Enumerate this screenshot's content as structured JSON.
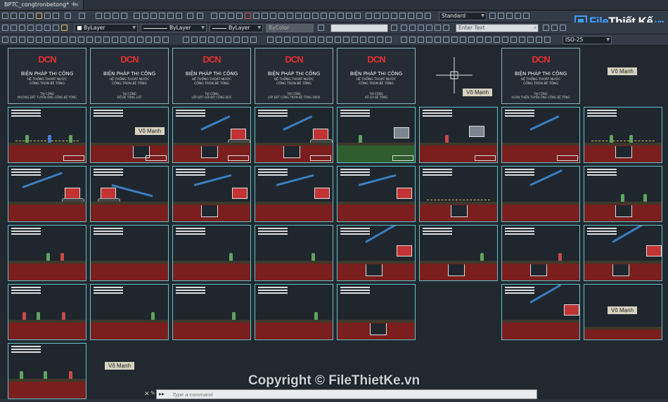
{
  "tabs": [
    {
      "label": "BPTC_congtronbetong*"
    }
  ],
  "tab_add": "+",
  "toolbar": {
    "text_style": "Standard",
    "layer_color": "ByLayer",
    "linetype": "ByLayer",
    "lineweight": "ByLayer",
    "plot_style": "ByColor",
    "enter_text_placeholder": "Enter Text",
    "dim_style": "ISO-25"
  },
  "brand": {
    "part1": "File",
    "part2": "Thiết Kế",
    "suffix": ".vn"
  },
  "covers": [
    {
      "logo": "DCN",
      "title": "BIỆN PHÁP THI CÔNG",
      "sub1": "HỆ THỐNG THOÁT NƯỚC",
      "sub2": "CỐNG TRÒN BÊ TÔNG",
      "step1": "THI CÔNG",
      "step2": "MƯƠNG ĐẤT TUYẾN ỐNG CỐNG BÊ TÔNG"
    },
    {
      "logo": "DCN",
      "title": "BIỆN PHÁP THI CÔNG",
      "sub1": "HỆ THỐNG THOÁT NƯỚC",
      "sub2": "CỐNG TRÒN BÊ TÔNG",
      "step1": "THI CÔNG",
      "step2": "ĐỔ BÊ TÔNG LÓT"
    },
    {
      "logo": "DCN",
      "title": "BIỆN PHÁP THI CÔNG",
      "sub1": "HỆ THỐNG THOÁT NƯỚC",
      "sub2": "CỐNG TRÒN BÊ TÔNG",
      "step1": "THI CÔNG",
      "step2": "LẮP ĐẶT GỐI ĐỠ CỐNG ĐÚC"
    },
    {
      "logo": "DCN",
      "title": "BIỆN PHÁP THI CÔNG",
      "sub1": "HỆ THỐNG THOÁT NƯỚC",
      "sub2": "CỐNG TRÒN BÊ TÔNG",
      "step1": "THI CÔNG",
      "step2": "LẮP ĐẶT CỐNG TRÒN BÊ TÔNG D600"
    },
    {
      "logo": "DCN",
      "title": "BIỆN PHÁP THI CÔNG",
      "sub1": "HỆ THỐNG THOÁT NƯỚC",
      "sub2": "CỐNG TRÒN BÊ TÔNG",
      "step1": "THI CÔNG",
      "step2": "HỐ GA BÊ TÔNG"
    },
    {
      "logo": "DCN",
      "title": "BIỆN PHÁP THI CÔNG",
      "sub1": "HỆ THỐNG THOÁT NƯỚC",
      "sub2": "CỐNG TRÒN BÊ TÔNG",
      "step1": "THI CÔNG",
      "step2": "HOÀN THIỆN TUYẾN ỐNG CỐNG BÊ TÔNG"
    }
  ],
  "labels": {
    "author": "Võ Mạnh"
  },
  "watermark": "Copyright © FileThietKe.vn",
  "command": {
    "prefix": "▸▸",
    "placeholder": "Type a command"
  }
}
